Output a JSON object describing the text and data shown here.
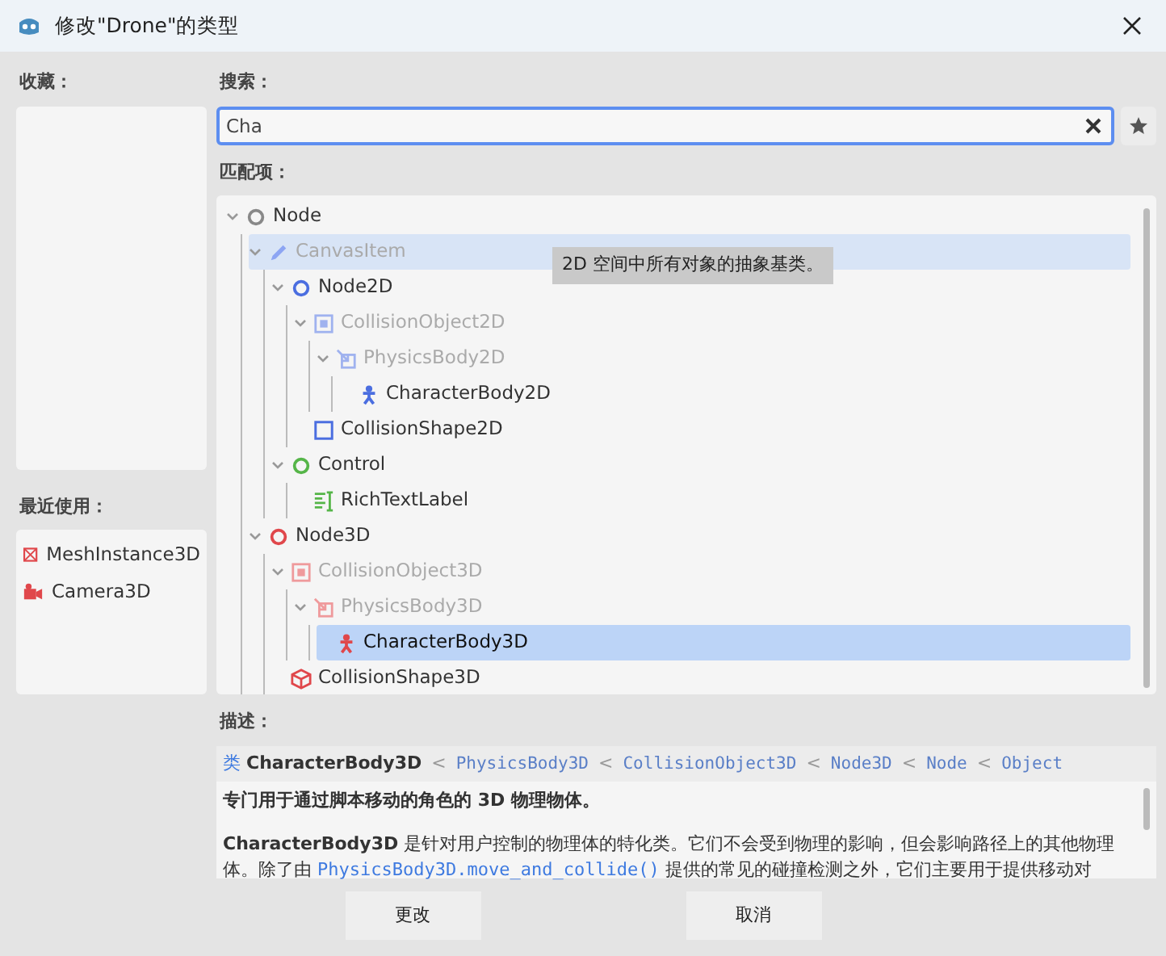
{
  "window": {
    "title": "修改\"Drone\"的类型"
  },
  "favorites": {
    "label": "收藏："
  },
  "recent": {
    "label": "最近使用：",
    "items": [
      {
        "text": "MeshInstance3D",
        "kind": "mesh",
        "color": "#e0474b"
      },
      {
        "text": "Camera3D",
        "kind": "camera",
        "color": "#e0474b"
      }
    ]
  },
  "search": {
    "label": "搜索：",
    "value": "Cha"
  },
  "matches": {
    "label": "匹配项：",
    "tree": [
      {
        "text": "Node",
        "kind": "circle",
        "color": "#888888",
        "expanded": true,
        "dimmed": false,
        "hovered": false,
        "selected": false,
        "children": [
          {
            "text": "CanvasItem",
            "kind": "pencil",
            "color": "#8da5f3",
            "expanded": true,
            "dimmed": true,
            "hovered": true,
            "selected": false,
            "children": [
              {
                "text": "Node2D",
                "kind": "circle",
                "color": "#4b6ee0",
                "expanded": true,
                "dimmed": false,
                "hovered": false,
                "selected": false,
                "children": [
                  {
                    "text": "CollisionObject2D",
                    "kind": "boxed",
                    "color": "#9fb2ef",
                    "expanded": true,
                    "dimmed": true,
                    "hovered": false,
                    "selected": false,
                    "children": [
                      {
                        "text": "PhysicsBody2D",
                        "kind": "body",
                        "color": "#9fb2ef",
                        "expanded": true,
                        "dimmed": true,
                        "hovered": false,
                        "selected": false,
                        "children": [
                          {
                            "text": "CharacterBody2D",
                            "kind": "figure",
                            "color": "#4b6ee0",
                            "dimmed": false,
                            "hovered": false,
                            "selected": false
                          }
                        ]
                      }
                    ]
                  },
                  {
                    "text": "CollisionShape2D",
                    "kind": "square",
                    "color": "#4b6ee0",
                    "dimmed": false,
                    "hovered": false,
                    "selected": false
                  }
                ]
              },
              {
                "text": "Control",
                "kind": "circle",
                "color": "#55b548",
                "expanded": true,
                "dimmed": false,
                "hovered": false,
                "selected": false,
                "children": [
                  {
                    "text": "RichTextLabel",
                    "kind": "richtext",
                    "color": "#55b548",
                    "dimmed": false,
                    "hovered": false,
                    "selected": false
                  }
                ]
              }
            ]
          },
          {
            "text": "Node3D",
            "kind": "circle",
            "color": "#e0474b",
            "expanded": true,
            "dimmed": false,
            "hovered": false,
            "selected": false,
            "children": [
              {
                "text": "CollisionObject3D",
                "kind": "boxed",
                "color": "#ef9a9c",
                "expanded": true,
                "dimmed": true,
                "hovered": false,
                "selected": false,
                "children": [
                  {
                    "text": "PhysicsBody3D",
                    "kind": "body",
                    "color": "#ef9a9c",
                    "expanded": true,
                    "dimmed": true,
                    "hovered": false,
                    "selected": false,
                    "children": [
                      {
                        "text": "CharacterBody3D",
                        "kind": "figure",
                        "color": "#e0474b",
                        "dimmed": false,
                        "hovered": false,
                        "selected": true
                      }
                    ]
                  }
                ]
              },
              {
                "text": "CollisionShape3D",
                "kind": "cube",
                "color": "#e0474b",
                "dimmed": false,
                "hovered": false,
                "selected": false
              }
            ]
          }
        ]
      }
    ]
  },
  "tooltip": {
    "text": "2D 空间中所有对象的抽象基类。"
  },
  "description": {
    "label": "描述：",
    "class_prefix": "类",
    "class_name": "CharacterBody3D",
    "separator": "<",
    "inherits": [
      "PhysicsBody3D",
      "CollisionObject3D",
      "Node3D",
      "Node",
      "Object"
    ],
    "summary": "专门用于通过脚本移动的角色的 3D 物理物体。",
    "paragraph": [
      {
        "kind": "bold",
        "text": "CharacterBody3D"
      },
      {
        "kind": "plain",
        "text": " 是针对用户控制的物理体的特化类。它们不会受到物理的影响，但会影响路径上的其他物理体。除了由 "
      },
      {
        "kind": "link",
        "text": "PhysicsBody3D.move_and_collide()"
      },
      {
        "kind": "plain",
        "text": " 提供的常见的碰撞检测之外，它们主要用于提供移动对"
      }
    ]
  },
  "buttons": [
    "更改",
    "取消"
  ]
}
